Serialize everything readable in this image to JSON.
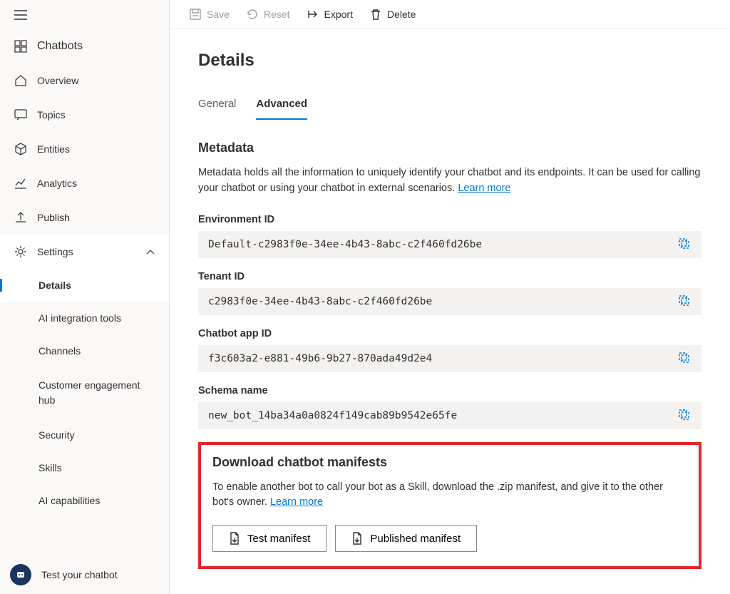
{
  "sidebar": {
    "chatbots": "Chatbots",
    "overview": "Overview",
    "topics": "Topics",
    "entities": "Entities",
    "analytics": "Analytics",
    "publish": "Publish",
    "settings": "Settings",
    "children": {
      "details": "Details",
      "ai_tools": "AI integration tools",
      "channels": "Channels",
      "engagement": "Customer engagement hub",
      "security": "Security",
      "skills": "Skills",
      "ai_caps": "AI capabilities"
    },
    "test_chatbot": "Test your chatbot"
  },
  "toolbar": {
    "save": "Save",
    "reset": "Reset",
    "export": "Export",
    "delete": "Delete"
  },
  "page": {
    "title": "Details",
    "tabs": {
      "general": "General",
      "advanced": "Advanced"
    }
  },
  "metadata": {
    "heading": "Metadata",
    "description": "Metadata holds all the information to uniquely identify your chatbot and its endpoints. It can be used for calling your chatbot or using your chatbot in external scenarios. ",
    "learn_more": "Learn more",
    "fields": {
      "env_id": {
        "label": "Environment ID",
        "value": "Default-c2983f0e-34ee-4b43-8abc-c2f460fd26be"
      },
      "tenant_id": {
        "label": "Tenant ID",
        "value": "c2983f0e-34ee-4b43-8abc-c2f460fd26be"
      },
      "app_id": {
        "label": "Chatbot app ID",
        "value": "f3c603a2-e881-49b6-9b27-870ada49d2e4"
      },
      "schema": {
        "label": "Schema name",
        "value": "new_bot_14ba34a0a0824f149cab89b9542e65fe"
      }
    }
  },
  "manifests": {
    "heading": "Download chatbot manifests",
    "description": "To enable another bot to call your bot as a Skill, download the .zip manifest, and give it to the other bot's owner. ",
    "learn_more": "Learn more",
    "test_btn": "Test manifest",
    "published_btn": "Published manifest"
  }
}
